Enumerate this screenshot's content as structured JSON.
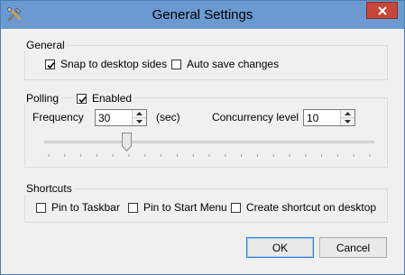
{
  "window": {
    "title": "General Settings"
  },
  "icons": {
    "app": "tools-icon",
    "close": "close-icon"
  },
  "general": {
    "legend": "General",
    "snap": {
      "label": "Snap to desktop sides",
      "checked": true
    },
    "autosave": {
      "label": "Auto save changes",
      "checked": false
    }
  },
  "polling": {
    "legend": "Polling",
    "enabled": {
      "label": "Enabled",
      "checked": true
    },
    "frequency": {
      "label": "Frequency",
      "value": "30",
      "unit": "(sec)"
    },
    "concurrency": {
      "label": "Concurrency level",
      "value": "10"
    },
    "slider_level": 0.25
  },
  "shortcuts": {
    "legend": "Shortcuts",
    "taskbar": {
      "label": "Pin to Taskbar",
      "checked": false
    },
    "startmenu": {
      "label": "Pin to Start Menu",
      "checked": false
    },
    "desktop": {
      "label": "Create shortcut on desktop",
      "checked": false
    }
  },
  "buttons": {
    "ok": "OK",
    "cancel": "Cancel"
  },
  "colors": {
    "titlebar": "#6b9ad1",
    "close": "#c7463a",
    "accent": "#2a7bd3"
  }
}
